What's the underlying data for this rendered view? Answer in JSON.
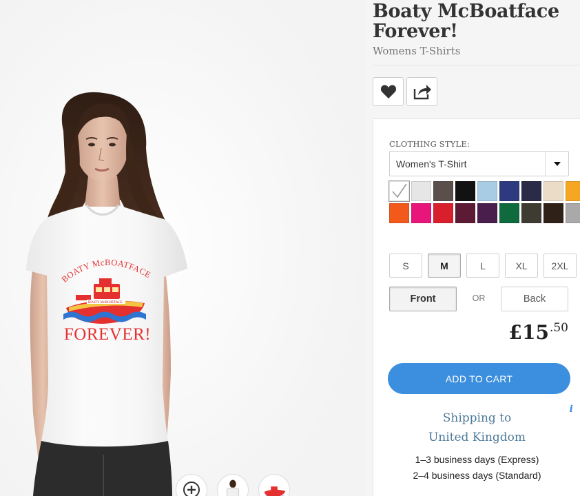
{
  "product": {
    "title": "Boaty McBoatface Forever!",
    "category": "Womens T-Shirts"
  },
  "shirt_print": {
    "top_text": "BOATY McBOATFACE",
    "boat_text": "BOATY McBOATFACE",
    "bottom_text": "FOREVER!"
  },
  "actions": {
    "favorite_icon": "heart-icon",
    "share_icon": "share-icon"
  },
  "options": {
    "clothing_style_label": "CLOTHING STYLE:",
    "clothing_style_value": "Women's T-Shirt",
    "colors": [
      "#ffffff",
      "#e6e6e6",
      "#5b4f4c",
      "#121212",
      "#a8cce4",
      "#2d3a80",
      "#2b2a47",
      "#eadcc6",
      "#f5a623",
      "#f25a1c",
      "#e8167a",
      "#d8202d",
      "#5c1a35",
      "#4a1e4c",
      "#0f6a3e",
      "#3e3b33",
      "#302118",
      "#a9a9a9"
    ],
    "selected_color_index": 0,
    "sizes": [
      "S",
      "M",
      "L",
      "XL",
      "2XL"
    ],
    "selected_size": "M",
    "side_front": "Front",
    "side_or": "OR",
    "side_back": "Back"
  },
  "price": {
    "main": "£15",
    "cents": ".50"
  },
  "cart": {
    "label": "ADD TO CART"
  },
  "shipping": {
    "info_icon": "i",
    "line1": "Shipping to",
    "line2": "United Kingdom",
    "express": "1–3 business days (Express)",
    "standard": "2–4 business days (Standard)"
  },
  "thumbnails": [
    "zoom-in-icon",
    "model-back-thumbnail",
    "design-thumbnail"
  ]
}
